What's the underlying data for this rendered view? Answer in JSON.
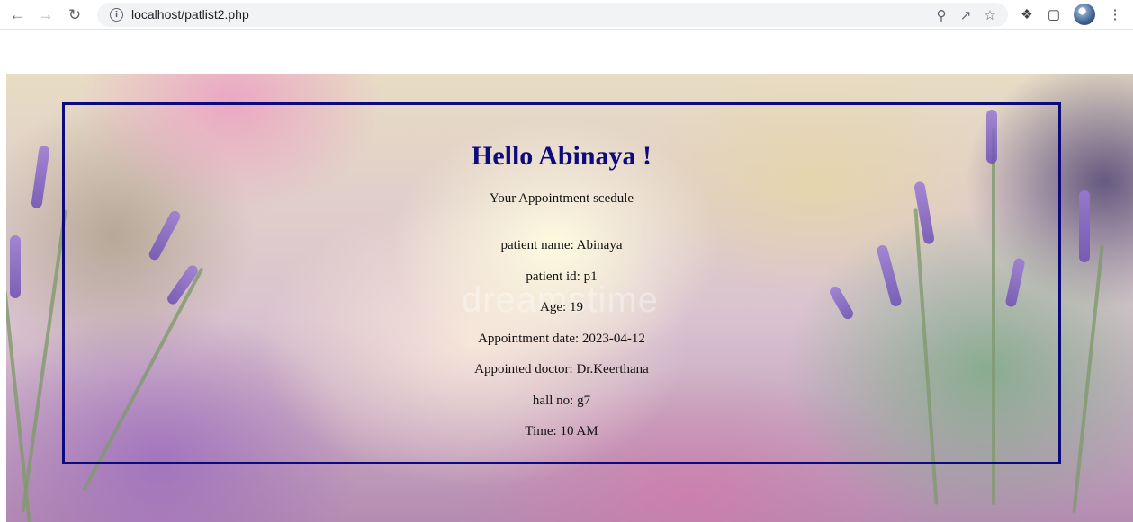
{
  "browser": {
    "url": "localhost/patlist2.php",
    "icons": {
      "back": "arrow-left-icon",
      "forward": "arrow-right-icon",
      "reload": "reload-icon",
      "site_info": "info-icon",
      "zoom": "magnifier-icon",
      "share": "share-icon",
      "bookmark": "star-icon",
      "extensions": "puzzle-icon",
      "side_panel": "side-panel-icon",
      "menu": "kebab-menu-icon"
    }
  },
  "page": {
    "greeting": "Hello Abinaya !",
    "subtitle": "Your Appointment scedule",
    "watermark": "dreamstime",
    "details": [
      "patient name: Abinaya",
      "patient id: p1",
      "Age: 19",
      "Appointment date: 2023-04-12",
      "Appointed doctor: Dr.Keerthana",
      "hall no: g7",
      "Time: 10 AM"
    ]
  },
  "colors": {
    "accent": "#0c0a7c",
    "text": "#111111",
    "toolbar_bg": "#f1f3f4"
  }
}
